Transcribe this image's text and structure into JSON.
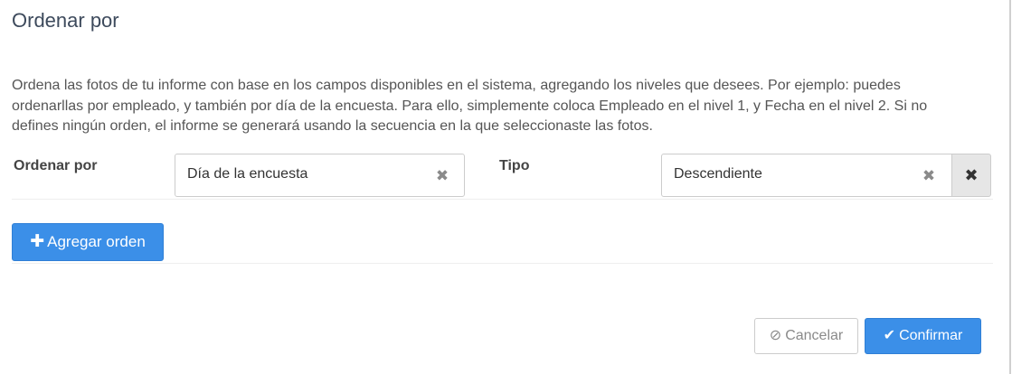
{
  "dialog": {
    "title": "Ordenar por",
    "description": "Ordena las fotos de tu informe con base en los campos disponibles en el sistema, agregando los niveles que desees. Por ejemplo: puedes ordenarllas por empleado, y también por día de la encuesta. Para ello, simplemente coloca Empleado en el nivel 1, y Fecha en el nivel 2. Si no defines ningún orden, el informe se generará usando la secuencia en la que seleccionaste las fotos."
  },
  "sort_rows": [
    {
      "order_label": "Ordenar por",
      "order_value": "Día de la encuesta",
      "type_label": "Tipo",
      "type_value": "Descendiente",
      "clear_icon": "times-icon",
      "remove_icon": "times-icon"
    }
  ],
  "actions": {
    "add_order_label": "Agregar orden",
    "add_order_icon": "plus-icon",
    "cancel_label": "Cancelar",
    "cancel_icon": "ban-icon",
    "confirm_label": "Confirmar",
    "confirm_icon": "check-icon"
  },
  "colors": {
    "primary": "#3b8fe8",
    "title": "#3d4a5c",
    "text": "#555555",
    "muted_icon": "#8a8a8a"
  }
}
